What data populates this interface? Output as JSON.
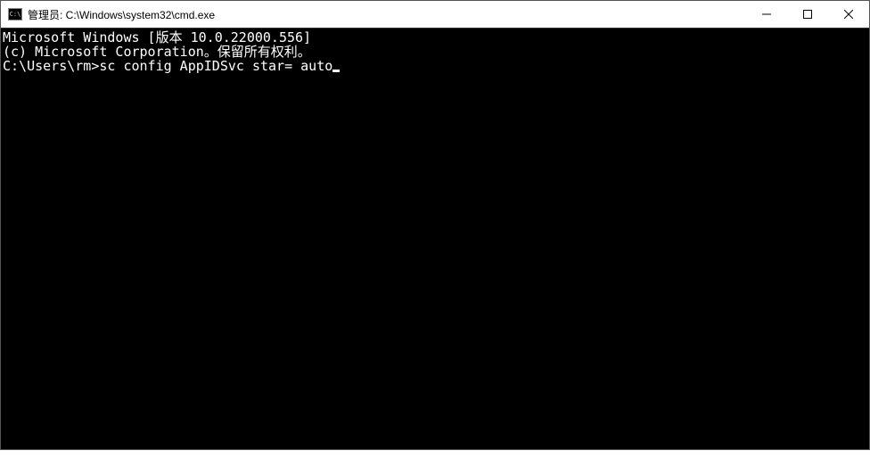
{
  "window": {
    "title": "管理员: C:\\Windows\\system32\\cmd.exe",
    "icon_label": "C:\\"
  },
  "terminal": {
    "lines": {
      "version": "Microsoft Windows [版本 10.0.22000.556]",
      "copyright": "(c) Microsoft Corporation。保留所有权利。",
      "blank": "",
      "prompt": "C:\\Users\\rm>",
      "command": "sc config AppIDSvc star= auto"
    }
  },
  "footer": {
    "partial_text": ""
  }
}
